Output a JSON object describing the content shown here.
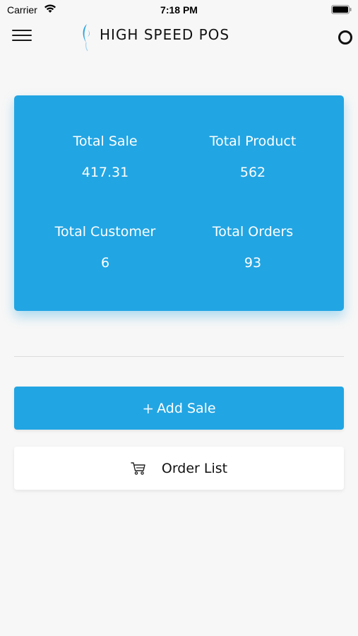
{
  "status_bar": {
    "carrier": "Carrier",
    "time": "7:18 PM"
  },
  "nav": {
    "title": "HIGH SPEED POS"
  },
  "stats": [
    {
      "label": "Total Sale",
      "value": "417.31"
    },
    {
      "label": "Total Product",
      "value": "562"
    },
    {
      "label": "Total Customer",
      "value": "6"
    },
    {
      "label": "Total Orders",
      "value": "93"
    }
  ],
  "actions": {
    "add_sale": "Add Sale",
    "add_sale_prefix": "+",
    "order_list": "Order List"
  },
  "colors": {
    "accent": "#22a5e3",
    "background": "#f7f7f7"
  },
  "icons": [
    "wifi-icon",
    "battery-icon",
    "menu-icon",
    "brand-logo",
    "profile-icon",
    "plus-icon",
    "cart-icon"
  ]
}
